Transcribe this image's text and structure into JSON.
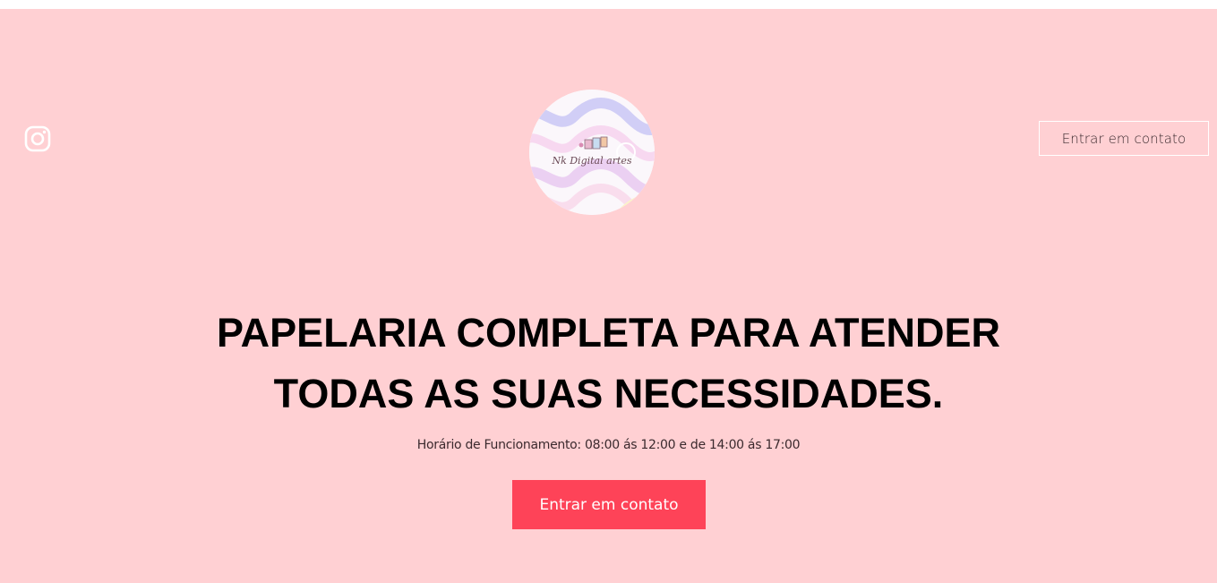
{
  "social": {
    "instagram_icon": "instagram-icon"
  },
  "logo": {
    "text": "Nk Digital artes"
  },
  "header": {
    "contact_button_label": "Entrar em contato"
  },
  "hero": {
    "headline_line1": "PAPELARIA COMPLETA PARA ATENDER",
    "headline_line2": "TODAS AS SUAS NECESSIDADES.",
    "hours_text": "Horário de Funcionamento: 08:00 ás 12:00 e de 14:00 ás 17:00",
    "cta_label": "Entrar em contato"
  },
  "colors": {
    "background": "#ffd0d3",
    "cta": "#fe4358",
    "headline": "#000000"
  }
}
